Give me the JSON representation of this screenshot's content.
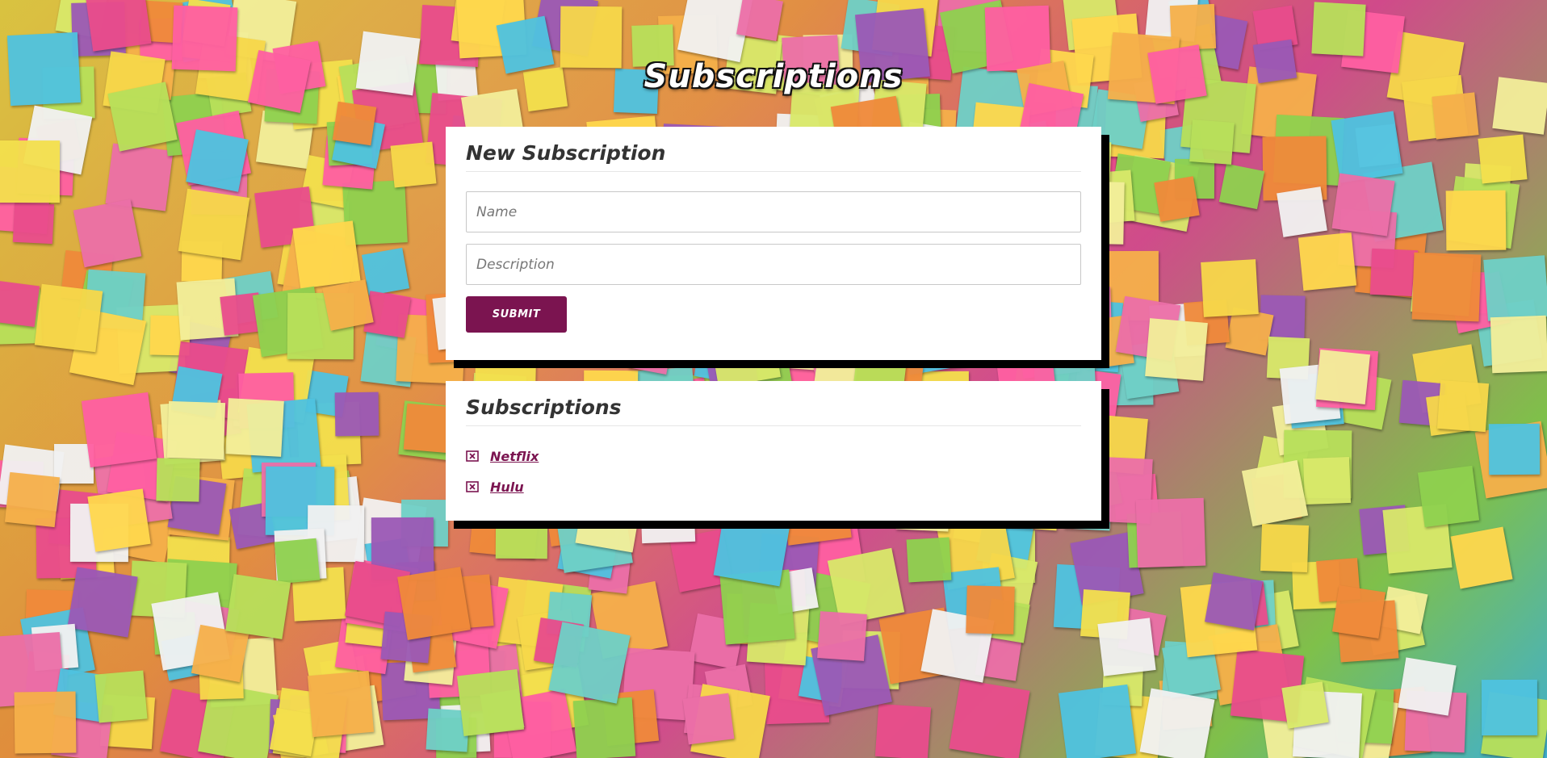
{
  "page": {
    "title": "Subscriptions"
  },
  "new_subscription": {
    "heading": "New Subscription",
    "name_placeholder": "Name",
    "name_value": "",
    "description_placeholder": "Description",
    "description_value": "",
    "submit_label": "SUBMIT"
  },
  "subscriptions": {
    "heading": "Subscriptions",
    "items": [
      {
        "label": "Netflix",
        "remove_icon": "remove-icon"
      },
      {
        "label": "Hulu",
        "remove_icon": "remove-icon"
      }
    ]
  },
  "colors": {
    "accent": "#7b1450",
    "card_background": "#ffffff",
    "card_shadow": "#000000",
    "title_text": "#ffffff"
  },
  "background": {
    "description_icon": "sticky-note-wall-image"
  }
}
